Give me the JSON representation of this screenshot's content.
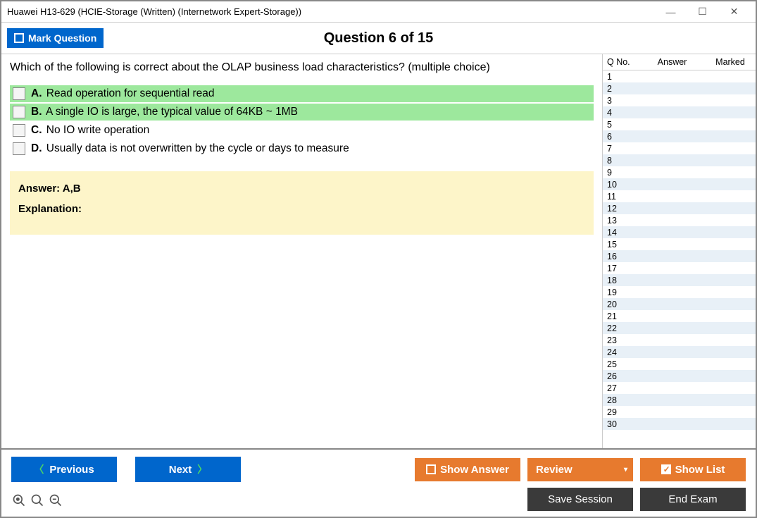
{
  "window": {
    "title": "Huawei H13-629 (HCIE-Storage (Written) (Internetwork Expert-Storage))"
  },
  "toolbar": {
    "mark_label": "Mark Question",
    "question_title": "Question 6 of 15"
  },
  "question": {
    "text": "Which of the following is correct about the OLAP business load characteristics? (multiple choice)",
    "options": [
      {
        "letter": "A.",
        "text": "Read operation for sequential read",
        "correct": true
      },
      {
        "letter": "B.",
        "text": "A single IO is large, the typical value of 64KB ~ 1MB",
        "correct": true
      },
      {
        "letter": "C.",
        "text": "No IO write operation",
        "correct": false
      },
      {
        "letter": "D.",
        "text": "Usually data is not overwritten by the cycle or days to measure",
        "correct": false
      }
    ],
    "answer_label": "Answer: A,B",
    "explanation_label": "Explanation:"
  },
  "sidebar": {
    "col_qno": "Q No.",
    "col_answer": "Answer",
    "col_marked": "Marked",
    "rows": 30
  },
  "footer": {
    "previous": "Previous",
    "next": "Next",
    "show_answer": "Show Answer",
    "review": "Review",
    "show_list": "Show List",
    "save_session": "Save Session",
    "end_exam": "End Exam"
  }
}
